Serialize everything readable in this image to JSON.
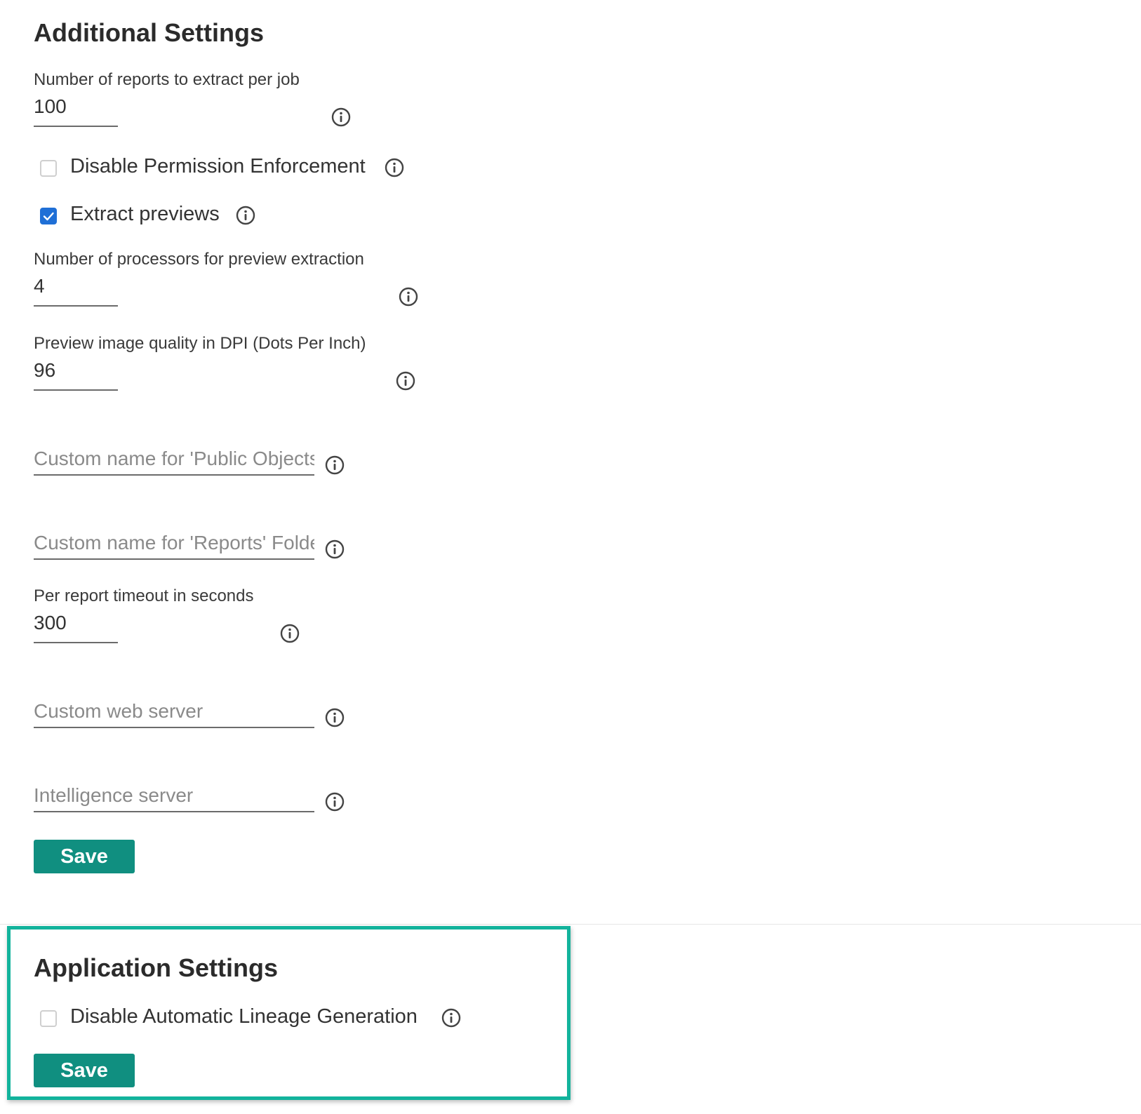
{
  "additional_settings": {
    "title": "Additional Settings",
    "reports_per_job": {
      "label": "Number of reports to extract per job",
      "value": "100"
    },
    "disable_permission": {
      "label": "Disable Permission Enforcement",
      "checked": false
    },
    "extract_previews": {
      "label": "Extract previews",
      "checked": true
    },
    "preview_processors": {
      "label": "Number of processors for preview extraction",
      "value": "4"
    },
    "preview_dpi": {
      "label": "Preview image quality in DPI (Dots Per Inch)",
      "value": "96"
    },
    "public_objects_name": {
      "placeholder": "Custom name for 'Public Objects' Folder"
    },
    "reports_folder_name": {
      "placeholder": "Custom name for 'Reports' Folder"
    },
    "report_timeout": {
      "label": "Per report timeout in seconds",
      "value": "300"
    },
    "custom_web_server": {
      "placeholder": "Custom web server"
    },
    "intelligence_server": {
      "placeholder": "Intelligence server"
    },
    "save_label": "Save"
  },
  "application_settings": {
    "title": "Application Settings",
    "disable_lineage": {
      "label": "Disable Automatic Lineage Generation",
      "checked": false
    },
    "save_label": "Save"
  },
  "icons": {
    "info": "info-circle-icon",
    "check": "checkmark-icon"
  },
  "colors": {
    "accent_button": "#108f80",
    "highlight_border": "#12b39c",
    "checkbox_checked": "#1f6fd6"
  }
}
